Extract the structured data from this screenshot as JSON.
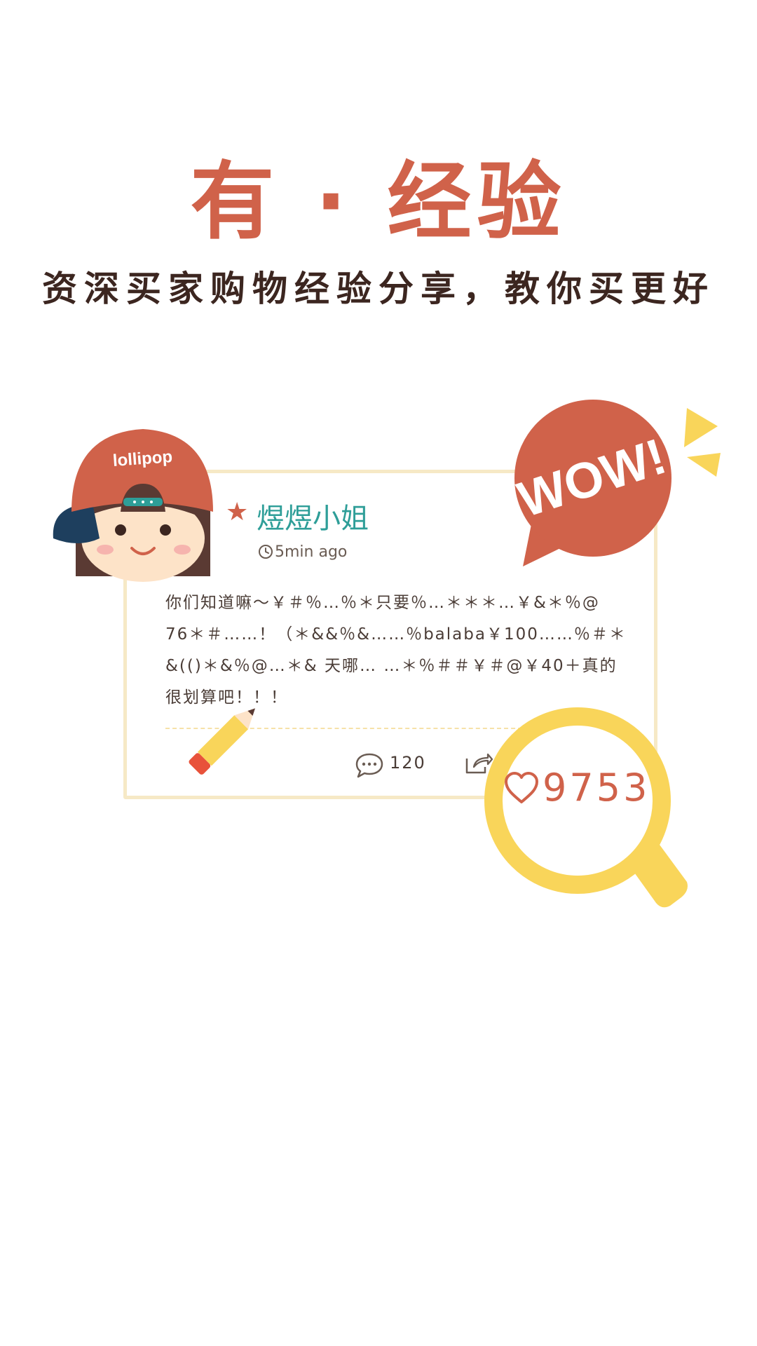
{
  "colors": {
    "accent": "#d0624a",
    "dark_text": "#3c2620",
    "teal": "#2e9e98",
    "card_border": "#f6e9c6",
    "yellow": "#f9d55a",
    "divider": "#f6e1a8"
  },
  "header": {
    "title": "有 · 经验",
    "subtitle": "资深买家购物经验分享，教你买更好"
  },
  "avatar": {
    "cap_text": "lollipop"
  },
  "post": {
    "username": "煜煜小姐",
    "time": "5min ago",
    "body": "你们知道嘛～￥＃％…％＊只要％…＊＊＊…￥&＊％@ 76＊＃……！（＊&&％&……％balaba￥100……％＃＊&(()＊&％@…＊& 天哪… …＊％＃＃￥＃@￥40＋真的很划算吧！！！",
    "comment_count": "120",
    "like_count": "9753"
  },
  "bubble": {
    "text": "WOW!"
  },
  "icons": [
    "star-icon",
    "clock-icon",
    "comment-icon",
    "share-icon",
    "heart-icon",
    "magnifier-icon",
    "pencil-icon"
  ]
}
